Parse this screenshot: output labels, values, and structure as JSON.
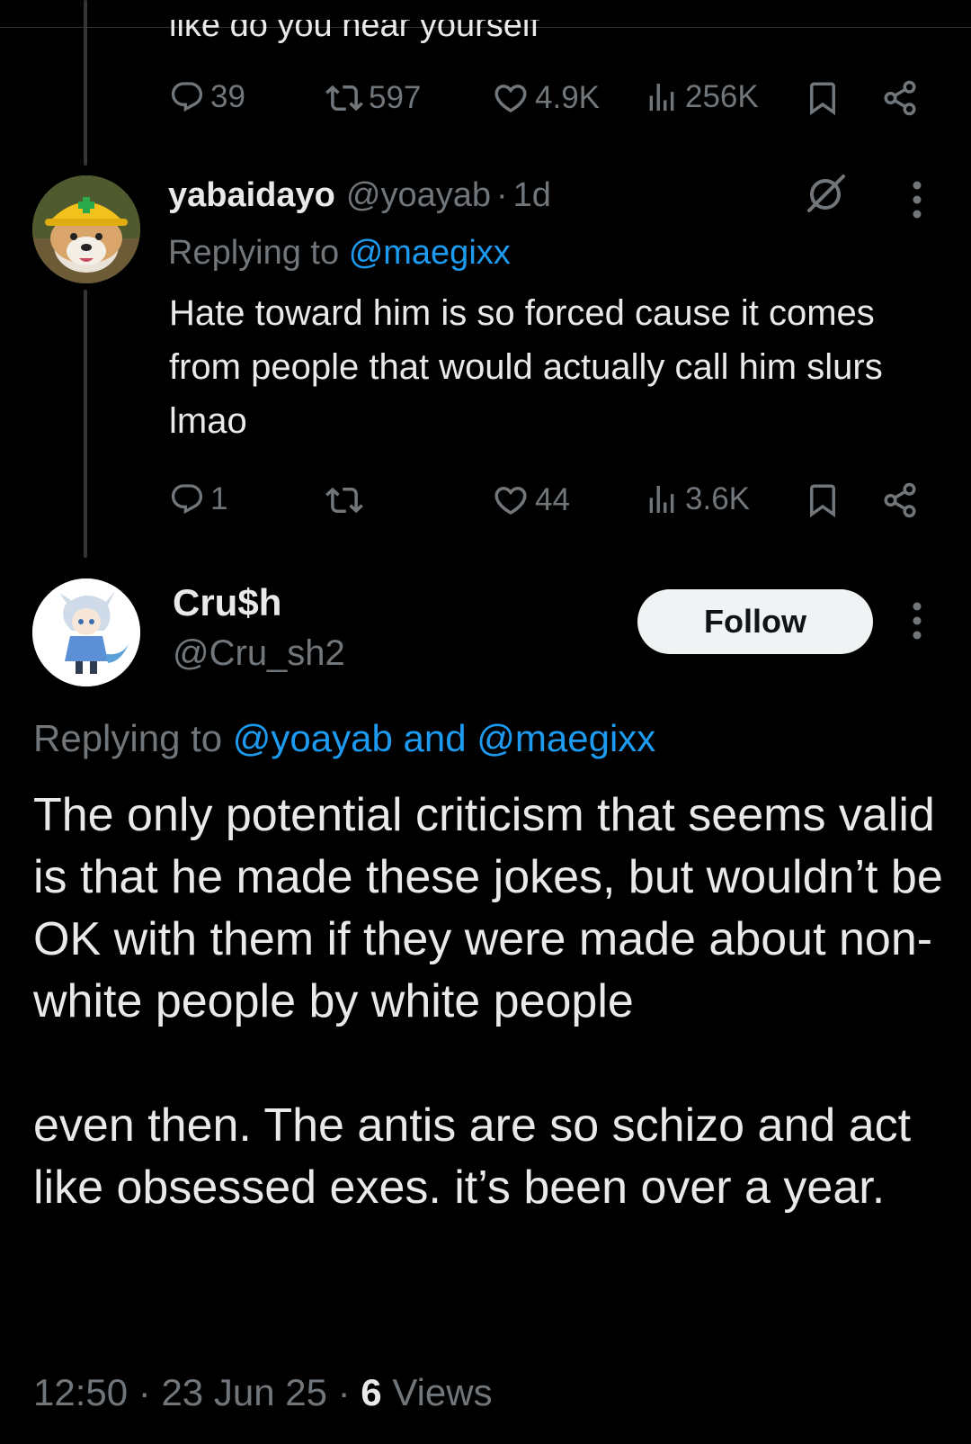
{
  "top_tweet": {
    "text": "like do you hear yourself",
    "stats": {
      "replies": "39",
      "retweets": "597",
      "likes": "4.9K",
      "views": "256K"
    }
  },
  "reply_tweet": {
    "display_name": "yabaidayo",
    "handle": "@yoayab",
    "separator": "·",
    "time": "1d",
    "replying_prefix": "Replying to",
    "replying_to": "@maegixx",
    "body": "Hate toward him is so forced cause it comes from people that would actually call him slurs lmao",
    "stats": {
      "replies": "1",
      "retweets": "",
      "likes": "44",
      "views": "3.6K"
    }
  },
  "main_tweet": {
    "display_name": "Cru$h",
    "handle": "@Cru_sh2",
    "follow_label": "Follow",
    "replying_prefix": "Replying to",
    "replying_to": "@yoayab and @maegixx",
    "body_p1": "The only potential criticism that seems valid is that he made these jokes, but wouldn’t be OK with them if they were made about non-white people by white people",
    "body_p2": "even then. The antis are so schizo and act like obsessed exes. it’s been over a year.",
    "time": "12:50",
    "date": "23 Jun 25",
    "separator": "·",
    "views_count": "6",
    "views_label": "Views"
  },
  "icons": {
    "reply": "reply-icon",
    "retweet": "retweet-icon",
    "like": "heart-icon",
    "views": "views-icon",
    "bookmark": "bookmark-icon",
    "share": "share-icon",
    "more": "more-vertical-icon",
    "grok": "grok-icon"
  },
  "colors": {
    "background": "#000000",
    "text": "#e7e9ea",
    "muted": "#71767b",
    "accent": "#1d9bf0",
    "follow_bg": "#eff3f4"
  }
}
